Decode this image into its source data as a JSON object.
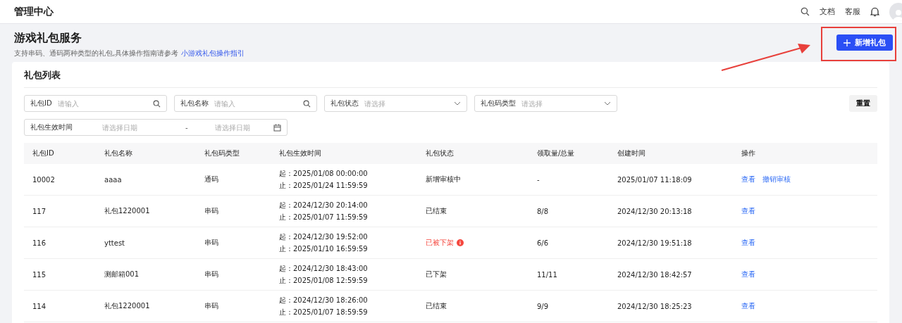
{
  "topbar": {
    "title": "管理中心",
    "links": [
      "文档",
      "客服"
    ]
  },
  "header": {
    "title": "游戏礼包服务",
    "description": "支持串码、通码两种类型的礼包,具体操作指南请参考",
    "link": "小游戏礼包操作指引",
    "add_button": "新增礼包"
  },
  "card": {
    "title": "礼包列表"
  },
  "filters": [
    {
      "kind": "search",
      "label": "礼包ID",
      "placeholder": "请输入"
    },
    {
      "kind": "search",
      "label": "礼包名称",
      "placeholder": "请输入"
    },
    {
      "kind": "select",
      "label": "礼包状态",
      "placeholder": "请选择"
    },
    {
      "kind": "select",
      "label": "礼包码类型",
      "placeholder": "请选择"
    }
  ],
  "reset_button": "重置",
  "date_filter": {
    "label": "礼包生效时间",
    "start_placeholder": "请选择日期",
    "separator": "-",
    "end_placeholder": "请选择日期"
  },
  "table": {
    "columns": [
      "礼包ID",
      "礼包名称",
      "礼包码类型",
      "礼包生效时间",
      "礼包状态",
      "领取量/总量",
      "创建时间",
      "操作"
    ],
    "rows": [
      {
        "id": "10002",
        "name": "aaaa",
        "code_type": "通码",
        "start": "起：2025/01/08 00:00:00",
        "end": "止：2025/01/24 11:59:59",
        "status": "新增审核中",
        "alert": false,
        "claimed": "-",
        "created": "2025/01/07 11:18:09",
        "actions": [
          "查看",
          "撤销审核"
        ]
      },
      {
        "id": "117",
        "name": "礼包1220001",
        "code_type": "串码",
        "start": "起：2024/12/30 20:14:00",
        "end": "止：2025/01/07 11:59:59",
        "status": "已结束",
        "alert": false,
        "claimed": "8/8",
        "created": "2024/12/30 20:13:18",
        "actions": [
          "查看"
        ]
      },
      {
        "id": "116",
        "name": "yttest",
        "code_type": "串码",
        "start": "起：2024/12/30 19:52:00",
        "end": "止：2025/01/10 16:59:59",
        "status": "已被下架",
        "alert": true,
        "claimed": "6/6",
        "created": "2024/12/30 19:51:18",
        "actions": [
          "查看"
        ]
      },
      {
        "id": "115",
        "name": "测邮箱001",
        "code_type": "串码",
        "start": "起：2024/12/30 18:43:00",
        "end": "止：2025/01/08 12:59:59",
        "status": "已下架",
        "alert": false,
        "claimed": "11/11",
        "created": "2024/12/30 18:42:57",
        "actions": [
          "查看"
        ]
      },
      {
        "id": "114",
        "name": "礼包1220001",
        "code_type": "串码",
        "start": "起：2024/12/30 18:26:00",
        "end": "止：2025/01/07 18:59:59",
        "status": "已结束",
        "alert": false,
        "claimed": "9/9",
        "created": "2024/12/30 18:25:23",
        "actions": [
          "查看"
        ]
      }
    ]
  }
}
